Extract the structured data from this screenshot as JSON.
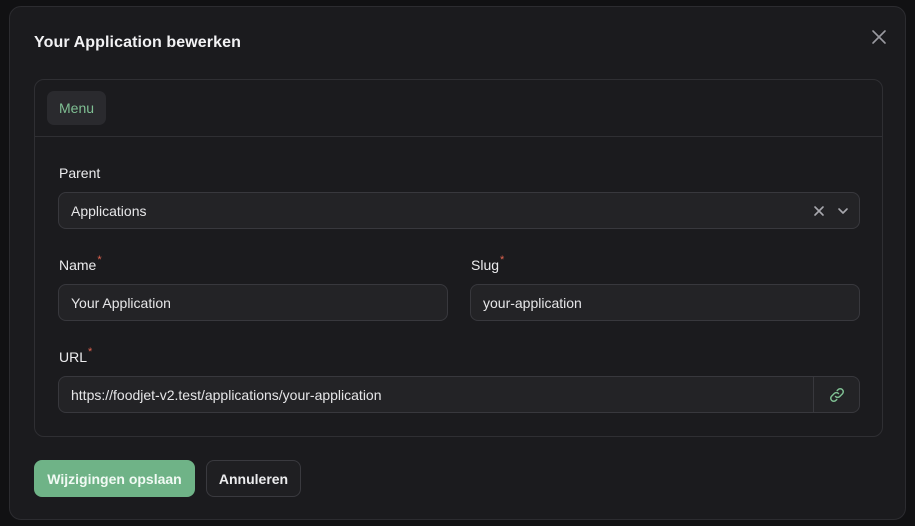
{
  "modal": {
    "title": "Your Application bewerken"
  },
  "tabs": [
    {
      "label": "Menu"
    }
  ],
  "form": {
    "parent": {
      "label": "Parent",
      "value": "Applications"
    },
    "name": {
      "label": "Name",
      "required_mark": "*",
      "value": "Your Application"
    },
    "slug": {
      "label": "Slug",
      "required_mark": "*",
      "value": "your-application"
    },
    "url": {
      "label": "URL",
      "required_mark": "*",
      "value": "https://foodjet-v2.test/applications/your-application"
    }
  },
  "actions": {
    "save_label": "Wijzigingen opslaan",
    "cancel_label": "Annuleren"
  },
  "colors": {
    "accent": "#6fb387",
    "required": "#e0634f",
    "tab_text": "#7fbf93"
  },
  "icons": {
    "close": "close-icon",
    "clear": "clear-x-icon",
    "chevron": "chevron-down-icon",
    "link": "link-icon"
  }
}
